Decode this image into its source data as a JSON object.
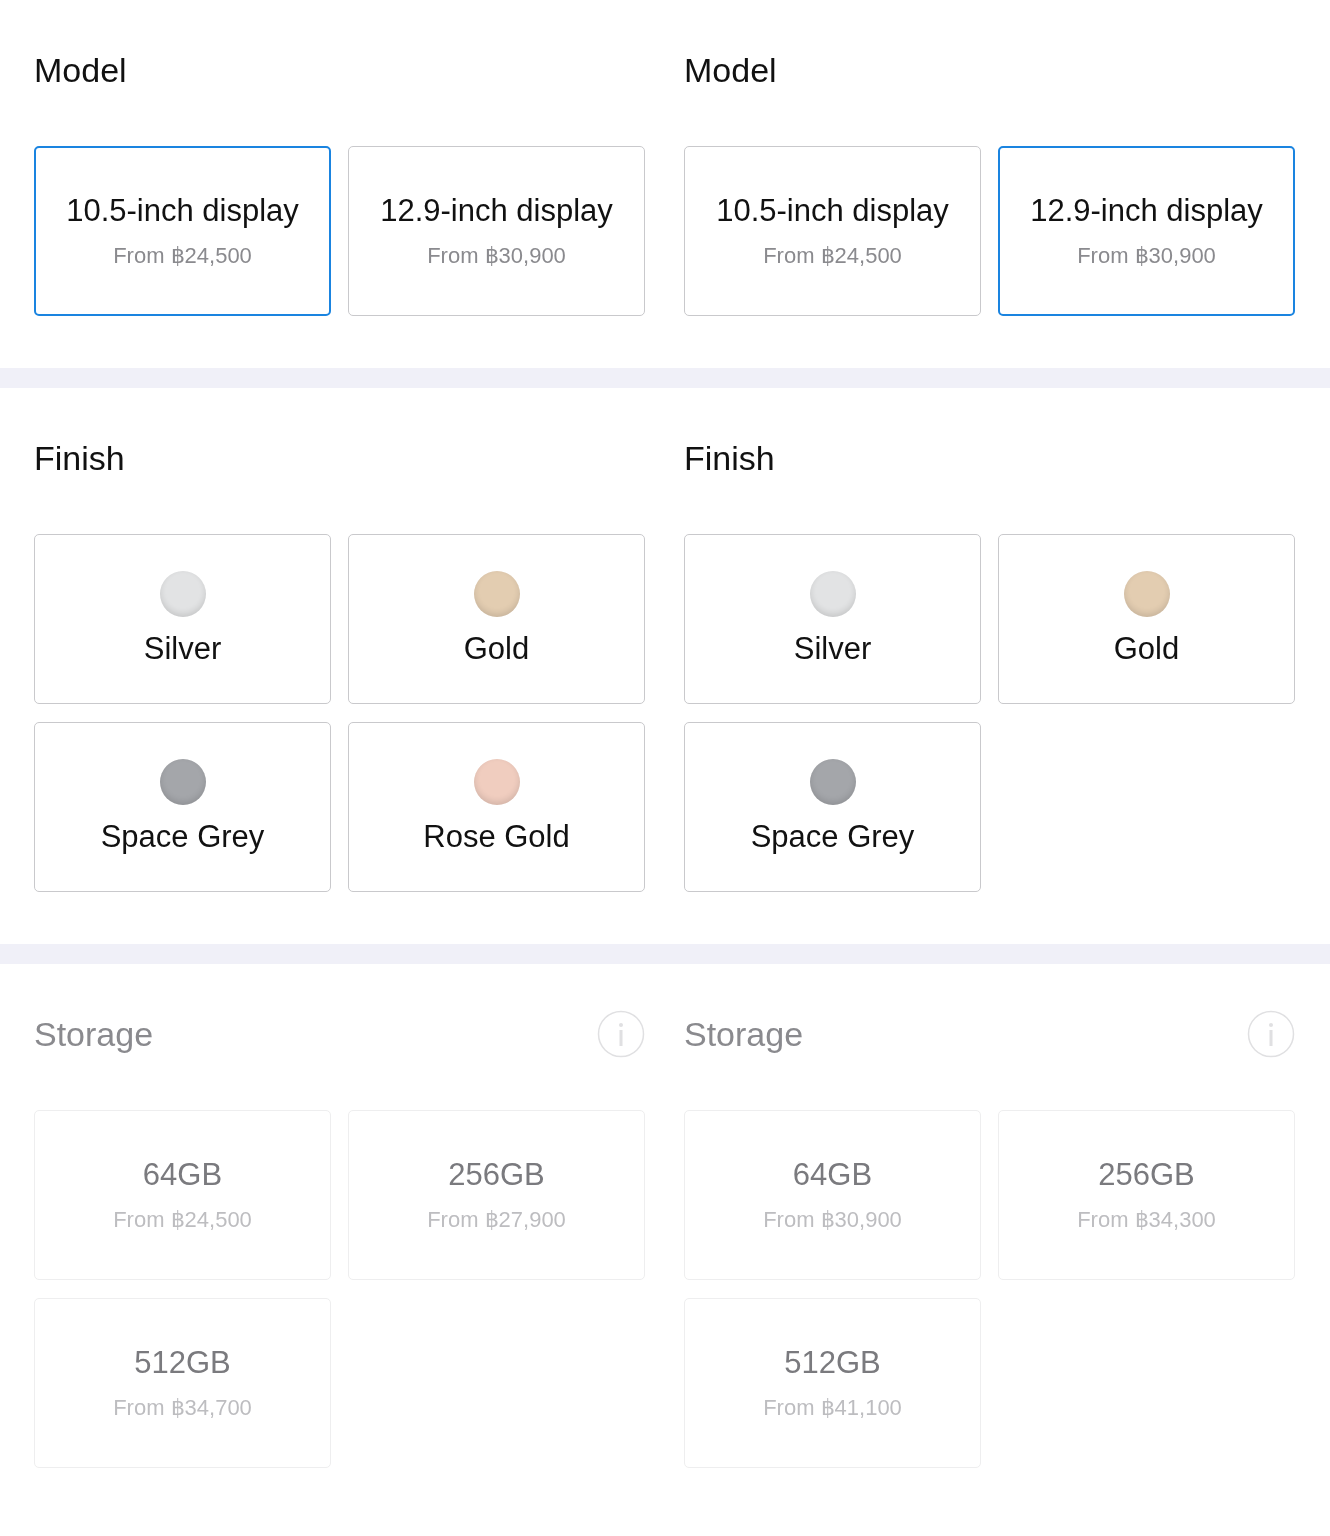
{
  "panels": [
    {
      "model": {
        "title": "Model",
        "options": [
          {
            "label": "10.5-inch display",
            "price": "From ฿24,500",
            "selected": true
          },
          {
            "label": "12.9-inch display",
            "price": "From ฿30,900",
            "selected": false
          }
        ]
      },
      "finish": {
        "title": "Finish",
        "options": [
          {
            "label": "Silver",
            "color": "#e2e3e4",
            "selected": false
          },
          {
            "label": "Gold",
            "color": "#e3cdb1",
            "selected": false
          },
          {
            "label": "Space Grey",
            "color": "#a4a6aa",
            "selected": false
          },
          {
            "label": "Rose Gold",
            "color": "#f0cdbf",
            "selected": false
          }
        ]
      },
      "storage": {
        "title": "Storage",
        "disabled": true,
        "options": [
          {
            "label": "64GB",
            "price": "From ฿24,500"
          },
          {
            "label": "256GB",
            "price": "From ฿27,900"
          },
          {
            "label": "512GB",
            "price": "From ฿34,700"
          }
        ]
      }
    },
    {
      "model": {
        "title": "Model",
        "options": [
          {
            "label": "10.5-inch display",
            "price": "From ฿24,500",
            "selected": false
          },
          {
            "label": "12.9-inch display",
            "price": "From ฿30,900",
            "selected": true
          }
        ]
      },
      "finish": {
        "title": "Finish",
        "options": [
          {
            "label": "Silver",
            "color": "#e2e3e4",
            "selected": false
          },
          {
            "label": "Gold",
            "color": "#e3cdb1",
            "selected": false
          },
          {
            "label": "Space Grey",
            "color": "#a4a6aa",
            "selected": false
          }
        ]
      },
      "storage": {
        "title": "Storage",
        "disabled": true,
        "options": [
          {
            "label": "64GB",
            "price": "From ฿30,900"
          },
          {
            "label": "256GB",
            "price": "From ฿34,300"
          },
          {
            "label": "512GB",
            "price": "From ฿41,100"
          }
        ]
      }
    }
  ]
}
